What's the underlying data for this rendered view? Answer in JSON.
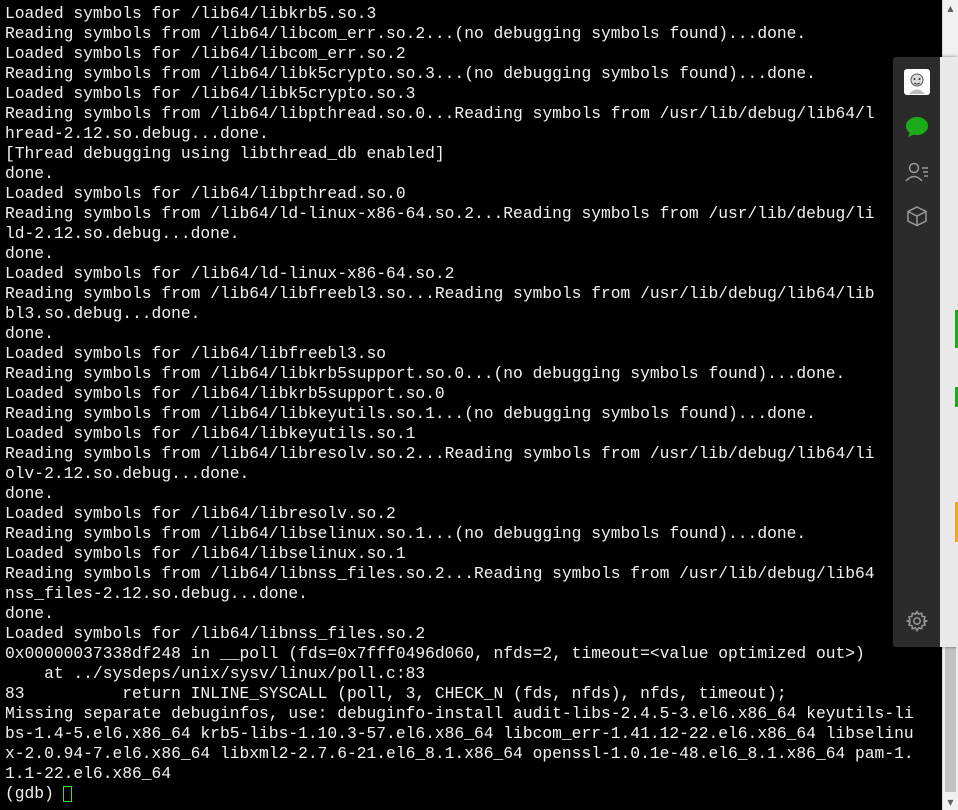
{
  "terminal": {
    "lines": [
      "Loaded symbols for /lib64/libkrb5.so.3",
      "Reading symbols from /lib64/libcom_err.so.2...(no debugging symbols found)...done.",
      "Loaded symbols for /lib64/libcom_err.so.2",
      "Reading symbols from /lib64/libk5crypto.so.3...(no debugging symbols found)...done.",
      "Loaded symbols for /lib64/libk5crypto.so.3",
      "Reading symbols from /lib64/libpthread.so.0...Reading symbols from /usr/lib/debug/lib64/l",
      "hread-2.12.so.debug...done.",
      "[Thread debugging using libthread_db enabled]",
      "done.",
      "Loaded symbols for /lib64/libpthread.so.0",
      "Reading symbols from /lib64/ld-linux-x86-64.so.2...Reading symbols from /usr/lib/debug/li",
      "ld-2.12.so.debug...done.",
      "done.",
      "Loaded symbols for /lib64/ld-linux-x86-64.so.2",
      "Reading symbols from /lib64/libfreebl3.so...Reading symbols from /usr/lib/debug/lib64/lib",
      "bl3.so.debug...done.",
      "done.",
      "Loaded symbols for /lib64/libfreebl3.so",
      "Reading symbols from /lib64/libkrb5support.so.0...(no debugging symbols found)...done.",
      "Loaded symbols for /lib64/libkrb5support.so.0",
      "Reading symbols from /lib64/libkeyutils.so.1...(no debugging symbols found)...done.",
      "Loaded symbols for /lib64/libkeyutils.so.1",
      "Reading symbols from /lib64/libresolv.so.2...Reading symbols from /usr/lib/debug/lib64/li",
      "olv-2.12.so.debug...done.",
      "done.",
      "Loaded symbols for /lib64/libresolv.so.2",
      "Reading symbols from /lib64/libselinux.so.1...(no debugging symbols found)...done.",
      "Loaded symbols for /lib64/libselinux.so.1",
      "Reading symbols from /lib64/libnss_files.so.2...Reading symbols from /usr/lib/debug/lib64",
      "nss_files-2.12.so.debug...done.",
      "done.",
      "Loaded symbols for /lib64/libnss_files.so.2",
      "0x00000037338df248 in __poll (fds=0x7fff0496d060, nfds=2, timeout=<value optimized out>)",
      "    at ../sysdeps/unix/sysv/linux/poll.c:83",
      "83          return INLINE_SYSCALL (poll, 3, CHECK_N (fds, nfds), nfds, timeout);",
      "Missing separate debuginfos, use: debuginfo-install audit-libs-2.4.5-3.el6.x86_64 keyutils-li",
      "bs-1.4-5.el6.x86_64 krb5-libs-1.10.3-57.el6.x86_64 libcom_err-1.41.12-22.el6.x86_64 libselinu",
      "x-2.0.94-7.el6.x86_64 libxml2-2.7.6-21.el6_8.1.x86_64 openssl-1.0.1e-48.el6_8.1.x86_64 pam-1.",
      "1.1-22.el6.x86_64"
    ],
    "prompt": "(gdb)",
    "cursor_color": "#2ee62e",
    "text_color": "#f2f2f2",
    "background_color": "#000000"
  },
  "side_panel": {
    "icons": [
      {
        "name": "avatar-icon",
        "color": "#ffffff"
      },
      {
        "name": "chat-bubble-icon",
        "color": "#1aad19"
      },
      {
        "name": "contacts-icon",
        "color": "#9a9a9a"
      },
      {
        "name": "box-icon",
        "color": "#9a9a9a"
      },
      {
        "name": "gear-icon",
        "color": "#9a9a9a"
      }
    ],
    "strip_marks": [
      "#1aad19",
      "#1aad19",
      "#f5a623"
    ]
  }
}
